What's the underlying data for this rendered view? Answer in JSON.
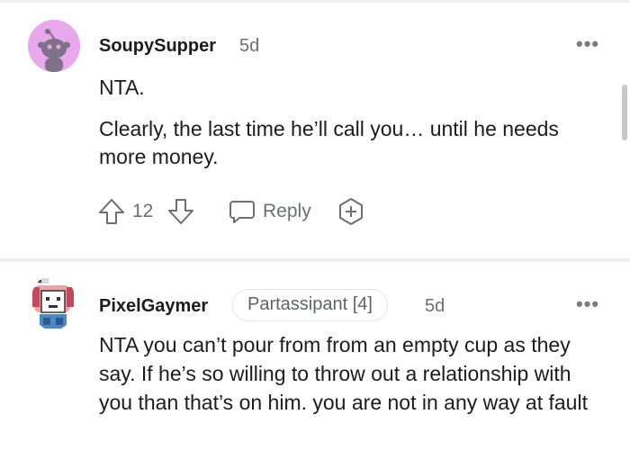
{
  "comments": [
    {
      "username": "SoupySupper",
      "age": "5d",
      "paragraphs": [
        "NTA.",
        "Clearly, the last time he’ll call you… until he needs more money."
      ],
      "votes": "12",
      "reply_label": "Reply",
      "avatar_icon": "snoo-avatar-icon",
      "avatar_color": "#e7a8ec"
    },
    {
      "username": "PixelGaymer",
      "flair": "Partassipant [4]",
      "age": "5d",
      "paragraphs": [
        "NTA you can’t pour from from an empty cup as they say. If he’s so willing to throw out a relationship with you than that’s on him. you are not in any way at fault"
      ],
      "avatar_icon": "pixel-character-avatar-icon"
    }
  ]
}
